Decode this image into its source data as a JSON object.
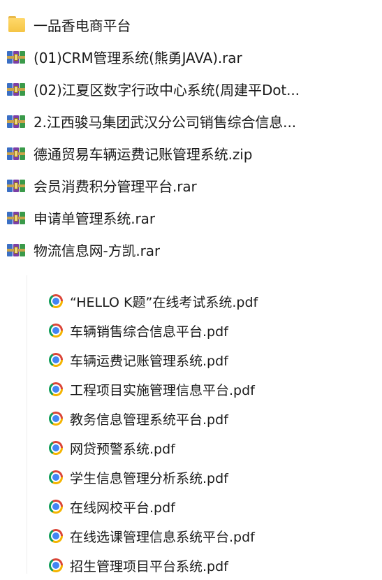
{
  "top_items": [
    {
      "label": "一品香电商平台",
      "icon": "folder-icon"
    },
    {
      "label": "(01)CRM管理系统(熊勇JAVA).rar",
      "icon": "archive-icon"
    },
    {
      "label": "(02)江夏区数字行政中心系统(周建平Dot...",
      "icon": "archive-icon"
    },
    {
      "label": "2.江西骏马集团武汉分公司销售综合信息...",
      "icon": "archive-icon"
    },
    {
      "label": "德通贸易车辆运费记账管理系统.zip",
      "icon": "archive-icon"
    },
    {
      "label": "会员消费积分管理平台.rar",
      "icon": "archive-icon"
    },
    {
      "label": "申请单管理系统.rar",
      "icon": "archive-icon"
    },
    {
      "label": "物流信息网-方凯.rar",
      "icon": "archive-icon"
    }
  ],
  "bottom_items": [
    {
      "label": "“HELLO K题”在线考试系统.pdf",
      "icon": "chrome-pdf-icon"
    },
    {
      "label": "车辆销售综合信息平台.pdf",
      "icon": "chrome-pdf-icon"
    },
    {
      "label": "车辆运费记账管理系统.pdf",
      "icon": "chrome-pdf-icon"
    },
    {
      "label": "工程项目实施管理信息平台.pdf",
      "icon": "chrome-pdf-icon"
    },
    {
      "label": "教务信息管理系统平台.pdf",
      "icon": "chrome-pdf-icon"
    },
    {
      "label": "网贷预警系统.pdf",
      "icon": "chrome-pdf-icon"
    },
    {
      "label": "学生信息管理分析系统.pdf",
      "icon": "chrome-pdf-icon"
    },
    {
      "label": "在线网校平台.pdf",
      "icon": "chrome-pdf-icon"
    },
    {
      "label": "在线选课管理信息系统平台.pdf",
      "icon": "chrome-pdf-icon"
    },
    {
      "label": "招生管理项目平台系统.pdf",
      "icon": "chrome-pdf-icon"
    }
  ]
}
